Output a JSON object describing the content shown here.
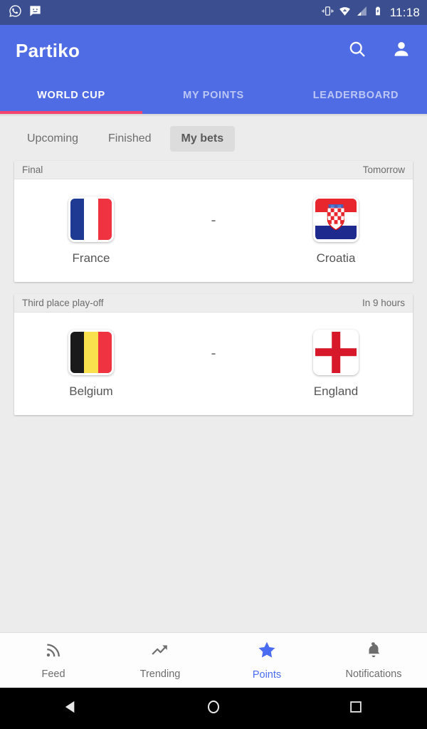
{
  "status_bar": {
    "time": "11:18",
    "left_icons": [
      "whatsapp-icon",
      "sms-icon"
    ],
    "right_icons": [
      "vibrate-icon",
      "wifi-icon",
      "signal-icon",
      "battery-charging-icon"
    ],
    "background_color": "#3b4f90"
  },
  "app_bar": {
    "title": "Partiko",
    "background_color": "#4f6ce4",
    "actions": [
      {
        "name": "search-icon",
        "label": "Search"
      },
      {
        "name": "account-icon",
        "label": "Account"
      }
    ]
  },
  "tabs": {
    "items": [
      {
        "label": "WORLD CUP",
        "active": true
      },
      {
        "label": "MY POINTS",
        "active": false
      },
      {
        "label": "LEADERBOARD",
        "active": false
      }
    ],
    "indicator_color": "#f4436c"
  },
  "filters": {
    "chips": [
      {
        "label": "Upcoming",
        "selected": false
      },
      {
        "label": "Finished",
        "selected": false
      },
      {
        "label": "My bets",
        "selected": true
      }
    ]
  },
  "matches": [
    {
      "stage": "Final",
      "time": "Tomorrow",
      "score": "-",
      "home": {
        "name": "France",
        "flag": "flag-france"
      },
      "away": {
        "name": "Croatia",
        "flag": "flag-croatia"
      }
    },
    {
      "stage": "Third place play-off",
      "time": "In 9 hours",
      "score": "-",
      "home": {
        "name": "Belgium",
        "flag": "flag-belgium"
      },
      "away": {
        "name": "England",
        "flag": "flag-england"
      }
    }
  ],
  "bottom_nav": {
    "active_color": "#4a6cf0",
    "items": [
      {
        "label": "Feed",
        "icon": "rss-icon",
        "active": false
      },
      {
        "label": "Trending",
        "icon": "trending-up-icon",
        "active": false
      },
      {
        "label": "Points",
        "icon": "star-icon",
        "active": true
      },
      {
        "label": "Notifications",
        "icon": "bell-icon",
        "active": false
      }
    ]
  },
  "android_nav": {
    "buttons": [
      {
        "name": "back-button",
        "icon": "back-triangle-icon"
      },
      {
        "name": "home-button",
        "icon": "home-circle-icon"
      },
      {
        "name": "recents-button",
        "icon": "recents-square-icon"
      }
    ]
  }
}
